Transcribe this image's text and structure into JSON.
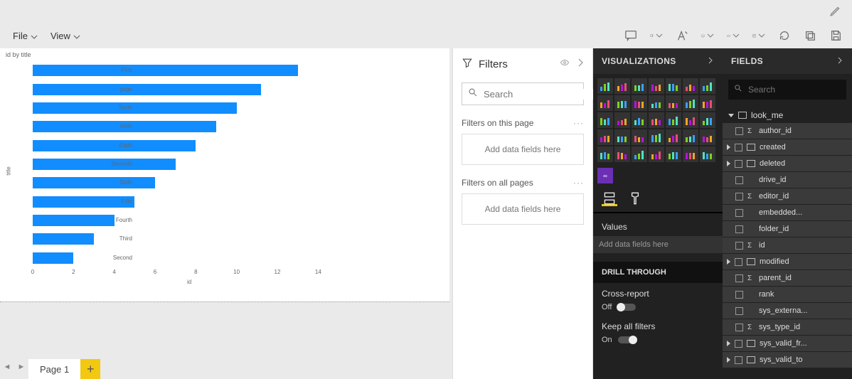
{
  "menu": {
    "file": "File",
    "view": "View"
  },
  "chart_data": {
    "type": "bar",
    "title": "id by title",
    "xlabel": "id",
    "ylabel": "title",
    "xlim": [
      0,
      15
    ],
    "xticks": [
      0,
      2,
      4,
      6,
      8,
      10,
      12,
      14
    ],
    "categories": [
      "First",
      "gage",
      "Tenth",
      "ninth",
      "Eigth",
      "Seventh",
      "Sixth",
      "Fifth",
      "Fourth",
      "Third",
      "Second"
    ],
    "values": [
      13,
      11.2,
      10,
      9,
      8,
      7,
      6,
      5,
      4,
      3,
      2
    ]
  },
  "page": {
    "current": "Page 1"
  },
  "filters": {
    "title": "Filters",
    "search_placeholder": "Search",
    "on_page": "Filters on this page",
    "on_all": "Filters on all pages",
    "drop_here": "Add data fields here"
  },
  "viz": {
    "title": "VISUALIZATIONS",
    "values_label": "Values",
    "values_drop": "Add data fields here",
    "drill_title": "DRILL THROUGH",
    "cross_report": "Cross-report",
    "cross_report_state": "Off",
    "keep_filters": "Keep all filters",
    "keep_filters_state": "On"
  },
  "fields": {
    "title": "FIELDS",
    "search_placeholder": "Search",
    "table": "look_me",
    "items": [
      {
        "label": "author_id",
        "sigma": true,
        "chev": false,
        "tbl": false
      },
      {
        "label": "created",
        "sigma": false,
        "chev": true,
        "tbl": true
      },
      {
        "label": "deleted",
        "sigma": false,
        "chev": true,
        "tbl": true
      },
      {
        "label": "drive_id",
        "sigma": false,
        "chev": false,
        "tbl": false
      },
      {
        "label": "editor_id",
        "sigma": true,
        "chev": false,
        "tbl": false
      },
      {
        "label": "embedded...",
        "sigma": false,
        "chev": false,
        "tbl": false
      },
      {
        "label": "folder_id",
        "sigma": false,
        "chev": false,
        "tbl": false
      },
      {
        "label": "id",
        "sigma": true,
        "chev": false,
        "tbl": false
      },
      {
        "label": "modified",
        "sigma": false,
        "chev": true,
        "tbl": true
      },
      {
        "label": "parent_id",
        "sigma": true,
        "chev": false,
        "tbl": false
      },
      {
        "label": "rank",
        "sigma": false,
        "chev": false,
        "tbl": false
      },
      {
        "label": "sys_externa...",
        "sigma": false,
        "chev": false,
        "tbl": false
      },
      {
        "label": "sys_type_id",
        "sigma": true,
        "chev": false,
        "tbl": false
      },
      {
        "label": "sys_valid_fr...",
        "sigma": false,
        "chev": true,
        "tbl": true
      },
      {
        "label": "sys_valid_to",
        "sigma": false,
        "chev": true,
        "tbl": true
      }
    ]
  }
}
